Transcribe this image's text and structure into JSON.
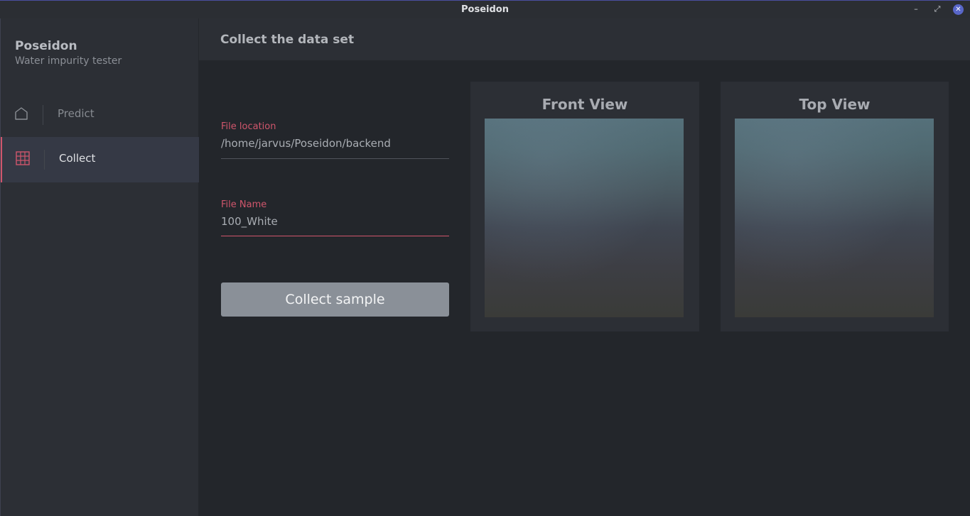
{
  "window": {
    "title": "Poseidon",
    "controls": {
      "minimize": "–",
      "maximize": "⤢",
      "close": "✕"
    }
  },
  "sidebar": {
    "app_name": "Poseidon",
    "app_subtitle": "Water impurity tester",
    "items": [
      {
        "label": "Predict",
        "icon": "home-icon",
        "active": false
      },
      {
        "label": "Collect",
        "icon": "grid-icon",
        "active": true
      }
    ]
  },
  "header": {
    "title": "Collect the data set"
  },
  "form": {
    "file_location": {
      "label": "File location",
      "value": "/home/jarvus/Poseidon/backend"
    },
    "file_name": {
      "label": "File Name",
      "value": "100_White"
    },
    "collect_button": "Collect sample"
  },
  "views": {
    "front": {
      "title": "Front View"
    },
    "top": {
      "title": "Top View"
    }
  },
  "colors": {
    "accent": "#d0566c",
    "background": "#23262b",
    "panel": "#2c2f35",
    "button": "#8a9098"
  }
}
